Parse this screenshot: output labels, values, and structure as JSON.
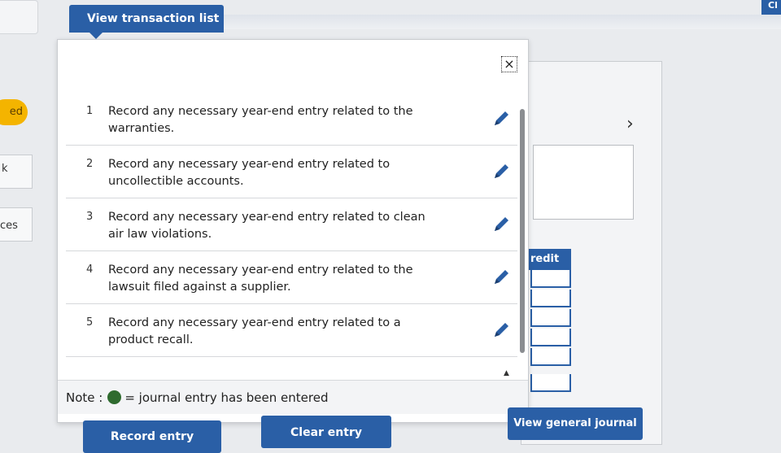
{
  "header": {
    "view_transaction_list": "View transaction list",
    "corner_button": "Cl"
  },
  "background": {
    "tab_fragment": "ed",
    "frag_k": "k",
    "frag_ces": "ces",
    "credit_header": "redit"
  },
  "popup": {
    "close_icon": "×",
    "transactions": [
      {
        "number": "1",
        "description": "Record any necessary year-end entry related to the warranties."
      },
      {
        "number": "2",
        "description": "Record any necessary year-end entry related to uncollectible accounts."
      },
      {
        "number": "3",
        "description": "Record any necessary year-end entry related to clean air law violations."
      },
      {
        "number": "4",
        "description": "Record any necessary year-end entry related to the lawsuit filed against a supplier."
      },
      {
        "number": "5",
        "description": "Record any necessary year-end entry related to a product recall."
      }
    ],
    "note": {
      "label": "Note :",
      "text": "= journal entry has been entered",
      "dot_color": "#2f6b2f"
    }
  },
  "footer": {
    "record_entry": "Record entry",
    "clear_entry": "Clear entry",
    "view_general_journal": "View general journal"
  },
  "colors": {
    "accent": "#2a5fa6",
    "tab": "#f4b400"
  }
}
